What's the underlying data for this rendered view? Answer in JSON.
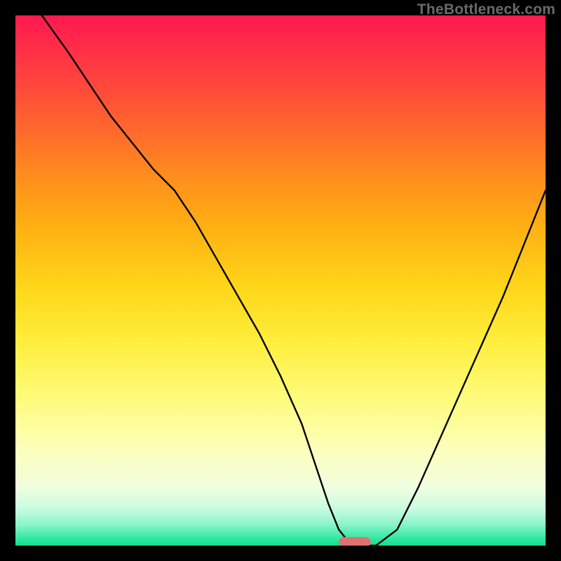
{
  "watermark": "TheBottleneck.com",
  "chart_data": {
    "type": "line",
    "title": "",
    "xlabel": "",
    "ylabel": "",
    "xlim": [
      0,
      100
    ],
    "ylim": [
      0,
      100
    ],
    "grid": false,
    "legend": false,
    "background": "vertical-gradient-red-yellow-green",
    "series": [
      {
        "name": "bottleneck-curve",
        "x": [
          5,
          10,
          14,
          18,
          22,
          26,
          30,
          34,
          38,
          42,
          46,
          50,
          54,
          57,
          59,
          61,
          63,
          64,
          68,
          72,
          76,
          80,
          84,
          88,
          92,
          96,
          100
        ],
        "y": [
          100,
          93,
          87,
          81,
          76,
          71,
          67,
          61,
          54,
          47,
          40,
          32,
          23,
          14,
          8,
          3,
          0.5,
          0,
          0,
          3,
          11,
          20,
          29,
          38,
          47,
          57,
          67
        ]
      }
    ],
    "marker": {
      "name": "optimal-range",
      "shape": "pill",
      "color": "#e0716e",
      "x_center": 64,
      "y_center": 0.6,
      "width_x": 6,
      "height_y": 2
    }
  }
}
